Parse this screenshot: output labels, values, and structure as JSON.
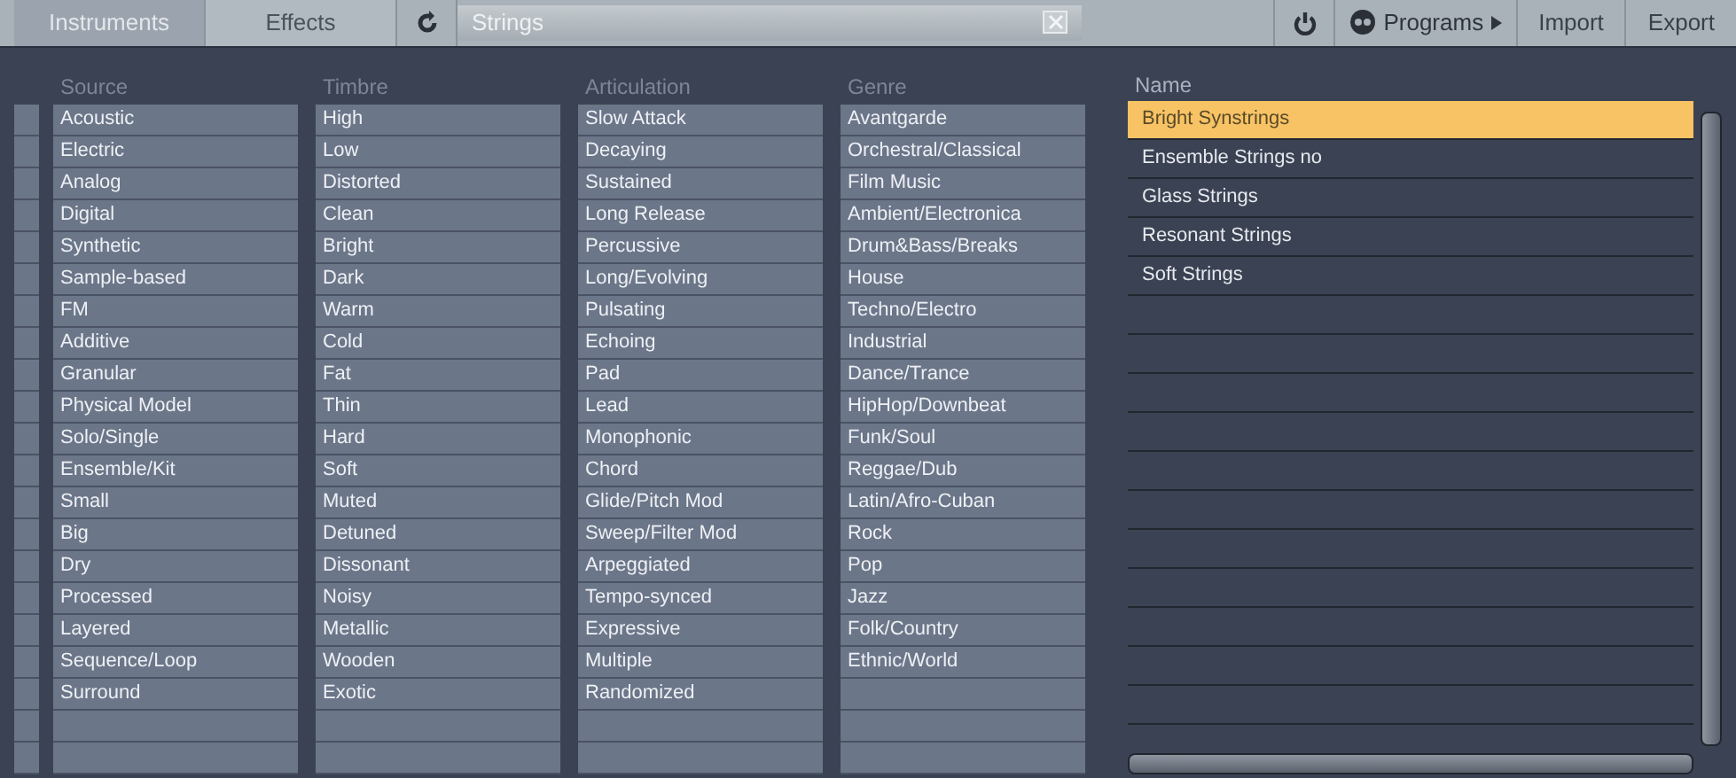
{
  "toolbar": {
    "tabs": [
      {
        "label": "Instruments",
        "selected": true
      },
      {
        "label": "Effects",
        "selected": false
      }
    ],
    "search": {
      "value": "Strings"
    },
    "programs": "Programs",
    "buttons": [
      "Import",
      "Export"
    ]
  },
  "attributes": [
    {
      "title": "Source",
      "items": [
        "Acoustic",
        "Electric",
        "Analog",
        "Digital",
        "Synthetic",
        "Sample-based",
        "FM",
        "Additive",
        "Granular",
        "Physical Model",
        "Solo/Single",
        "Ensemble/Kit",
        "Small",
        "Big",
        "Dry",
        "Processed",
        "Layered",
        "Sequence/Loop",
        "Surround"
      ]
    },
    {
      "title": "Timbre",
      "items": [
        "High",
        "Low",
        "Distorted",
        "Clean",
        "Bright",
        "Dark",
        "Warm",
        "Cold",
        "Fat",
        "Thin",
        "Hard",
        "Soft",
        "Muted",
        "Detuned",
        "Dissonant",
        "Noisy",
        "Metallic",
        "Wooden",
        "Exotic"
      ]
    },
    {
      "title": "Articulation",
      "items": [
        "Slow Attack",
        "Decaying",
        "Sustained",
        "Long Release",
        "Percussive",
        "Long/Evolving",
        "Pulsating",
        "Echoing",
        "Pad",
        "Lead",
        "Monophonic",
        "Chord",
        "Glide/Pitch Mod",
        "Sweep/Filter Mod",
        "Arpeggiated",
        "Tempo-synced",
        "Expressive",
        "Multiple",
        "Randomized"
      ]
    },
    {
      "title": "Genre",
      "items": [
        "Avantgarde",
        "Orchestral/Classical",
        "Film Music",
        "Ambient/Electronica",
        "Drum&Bass/Breaks",
        "House",
        "Techno/Electro",
        "Industrial",
        "Dance/Trance",
        "HipHop/Downbeat",
        "Funk/Soul",
        "Reggae/Dub",
        "Latin/Afro-Cuban",
        "Rock",
        "Pop",
        "Jazz",
        "Folk/Country",
        "Ethnic/World"
      ]
    }
  ],
  "results": {
    "column": "Name",
    "rows": [
      {
        "name": "Bright Synstrings",
        "selected": true
      },
      {
        "name": "Ensemble Strings no",
        "selected": false
      },
      {
        "name": "Glass Strings",
        "selected": false
      },
      {
        "name": "Resonant Strings",
        "selected": false
      },
      {
        "name": "Soft Strings",
        "selected": false
      }
    ]
  }
}
